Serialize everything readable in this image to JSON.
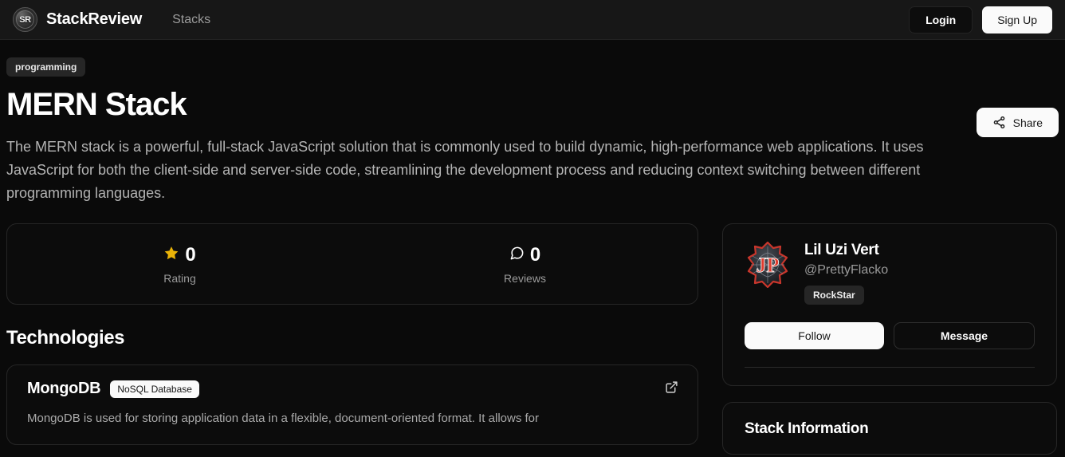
{
  "header": {
    "logo_text": "SR",
    "brand": "StackReview",
    "nav": [
      {
        "label": "Stacks"
      }
    ],
    "login_label": "Login",
    "signup_label": "Sign Up"
  },
  "hero": {
    "tag": "programming",
    "title": "MERN Stack",
    "description": "The MERN stack is a powerful, full-stack JavaScript solution that is commonly used to build dynamic, high-performance web applications. It uses JavaScript for both the client-side and server-side code, streamlining the development process and reducing context switching between different programming languages.",
    "share_label": "Share"
  },
  "stats": [
    {
      "icon": "star-icon",
      "value": "0",
      "label": "Rating",
      "color": "#eab308"
    },
    {
      "icon": "comment-icon",
      "value": "0",
      "label": "Reviews",
      "color": "#ffffff"
    }
  ],
  "technologies_section": {
    "title": "Technologies",
    "items": [
      {
        "name": "MongoDB",
        "badge": "NoSQL Database",
        "description": "MongoDB is used for storing application data in a flexible, document-oriented format. It allows for"
      }
    ]
  },
  "profile": {
    "avatar_alt": "JP",
    "name": "Lil Uzi Vert",
    "handle": "@PrettyFlacko",
    "role_badge": "RockStar",
    "follow_label": "Follow",
    "message_label": "Message"
  },
  "stack_info": {
    "title": "Stack Information"
  },
  "colors": {
    "page_bg": "#0a0a0a",
    "header_bg": "#171717",
    "card_bg": "#0c0c0c",
    "card_border": "#262626",
    "accent_white": "#fafafa",
    "star_gold": "#eab308",
    "muted_text": "#9b9b9b"
  }
}
